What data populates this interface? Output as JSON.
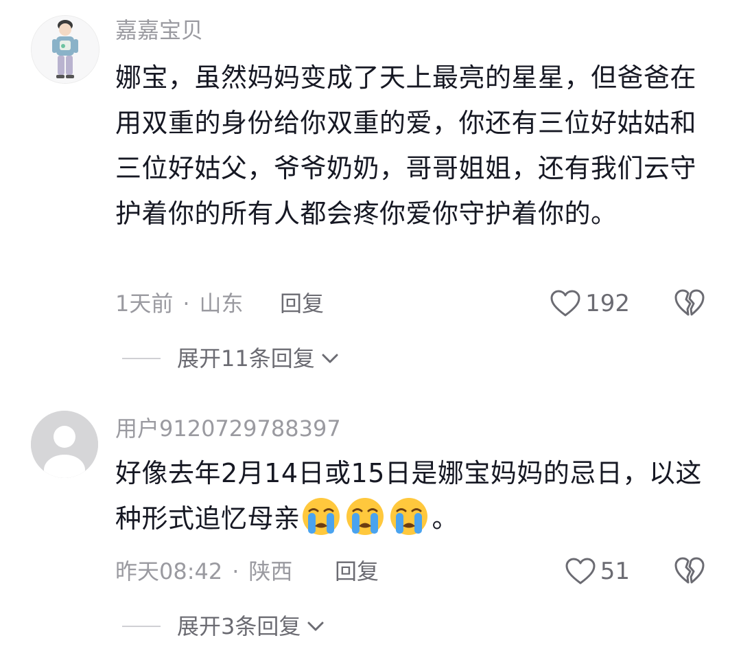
{
  "comments": [
    {
      "username": "嘉嘉宝贝",
      "text": "娜宝，虽然妈妈变成了天上最亮的星星，但爸爸在用双重的身份给你双重的爱，你还有三位好姑姑和三位好姑父，爷爷奶奶，哥哥姐姐，还有我们云守护着你的所有人都会疼你爱你守护着你的。",
      "time": "1天前",
      "location": "山东",
      "reply_label": "回复",
      "likes": "192",
      "expand_label": "展开11条回复"
    },
    {
      "username": "用户9120729788397",
      "text": "好像去年2月14日或15日是娜宝妈妈的忌日，以这种形式追忆母亲",
      "text_end": "。",
      "emoji": "crying-face-emoji",
      "emoji_count": 3,
      "time": "昨天08:42",
      "location": "陕西",
      "reply_label": "回复",
      "likes": "51",
      "expand_label": "展开3条回复"
    }
  ],
  "colors": {
    "text": "#161823",
    "secondary": "#9a9aa0",
    "icon": "#6b6b72"
  }
}
